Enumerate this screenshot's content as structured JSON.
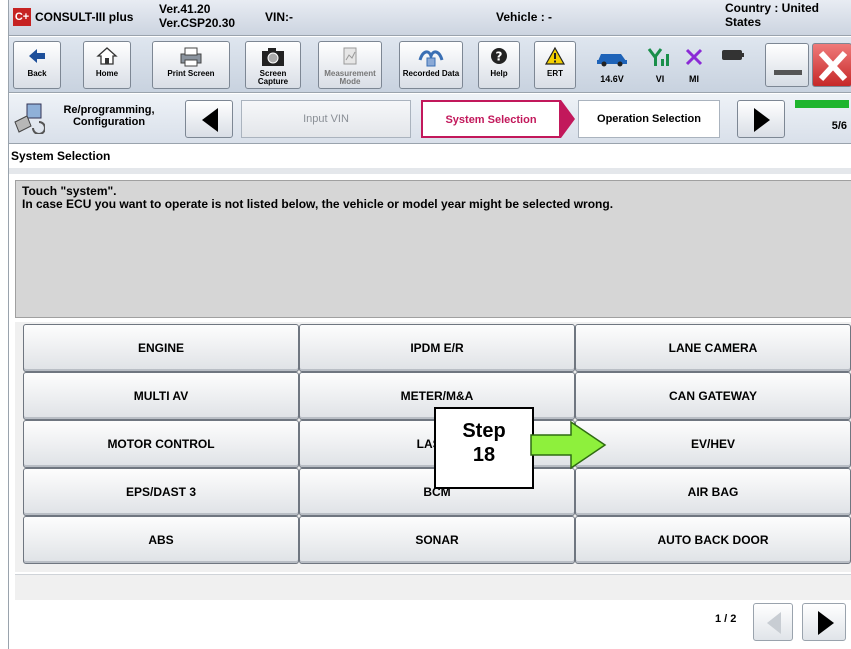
{
  "titlebar": {
    "app_logo": "C+",
    "app_name": "CONSULT-III plus",
    "version_line1": "Ver.41.20",
    "version_line2": "Ver.CSP20.30",
    "vin": "VIN:-",
    "vehicle": "Vehicle : -",
    "country": "Country : United States"
  },
  "toolbar": {
    "buttons": [
      {
        "label": "Back",
        "icon": "back-arrow-icon"
      },
      {
        "label": "Home",
        "icon": "home-icon"
      },
      {
        "label": "Print Screen",
        "icon": "printer-icon"
      },
      {
        "label": "Screen Capture",
        "icon": "camera-icon"
      },
      {
        "label": "Measurement Mode",
        "icon": "measurement-icon"
      },
      {
        "label": "Recorded Data",
        "icon": "recorded-data-icon"
      },
      {
        "label": "Help",
        "icon": "help-icon"
      },
      {
        "label": "ERT",
        "icon": "warning-icon"
      }
    ],
    "status": {
      "voltage": "14.6V",
      "vi": "VI",
      "mi": "MI"
    }
  },
  "stepbar": {
    "mode_label": "Re/programming, Configuration",
    "crumbs": [
      "Input VIN",
      "System Selection",
      "Operation Selection"
    ],
    "progress": "5/6",
    "progress_fraction": 0.83
  },
  "section": {
    "title": "System Selection"
  },
  "message": {
    "line1": "Touch \"system\".",
    "line2": "In case ECU you want to operate is not listed below, the vehicle or model year might be selected wrong."
  },
  "systems": [
    [
      "ENGINE",
      "IPDM E/R",
      "LANE CAMERA"
    ],
    [
      "MULTI AV",
      "METER/M&A",
      "CAN GATEWAY"
    ],
    [
      "MOTOR CONTROL",
      "LASER",
      "EV/HEV"
    ],
    [
      "EPS/DAST 3",
      "BCM",
      "AIR BAG"
    ],
    [
      "ABS",
      "SONAR",
      "AUTO BACK DOOR"
    ]
  ],
  "pager": {
    "page": "1 / 2"
  },
  "callout": {
    "line1": "Step",
    "line2": "18"
  },
  "colors": {
    "active_crumb": "#c2185b",
    "progress": "#1fb52e",
    "arrow_fill": "#8ef03c",
    "close": "#c62828"
  }
}
